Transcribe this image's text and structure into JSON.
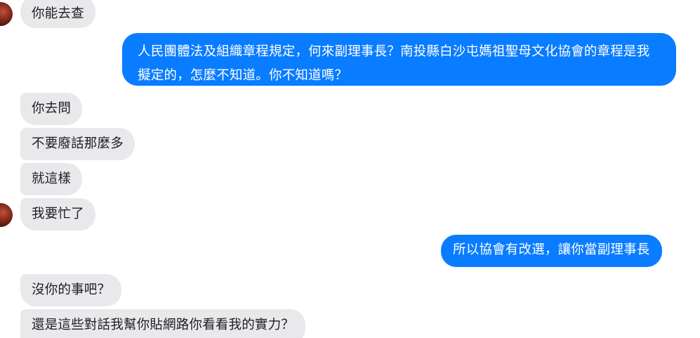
{
  "messages": [
    {
      "side": "in",
      "text": "你能去查"
    },
    {
      "side": "out",
      "text": "人民團體法及組織章程規定，何來副理事長？南投縣白沙屯媽祖聖母文化協會的章程是我擬定的，怎麼不知道。你不知道嗎？"
    },
    {
      "side": "in",
      "text": "你去問"
    },
    {
      "side": "in",
      "text": "不要廢話那麼多"
    },
    {
      "side": "in",
      "text": "就這樣"
    },
    {
      "side": "in",
      "text": "我要忙了"
    },
    {
      "side": "out",
      "text": "所以協會有改選，讓你當副理事長"
    },
    {
      "side": "in",
      "text": "沒你的事吧？"
    },
    {
      "side": "in",
      "text": "還是這些對話我幫你貼網路你看看我的實力？"
    }
  ],
  "colors": {
    "outgoing_bubble": "#0a7cff",
    "incoming_bubble": "#e9e9ec",
    "background": "#ffffff"
  }
}
